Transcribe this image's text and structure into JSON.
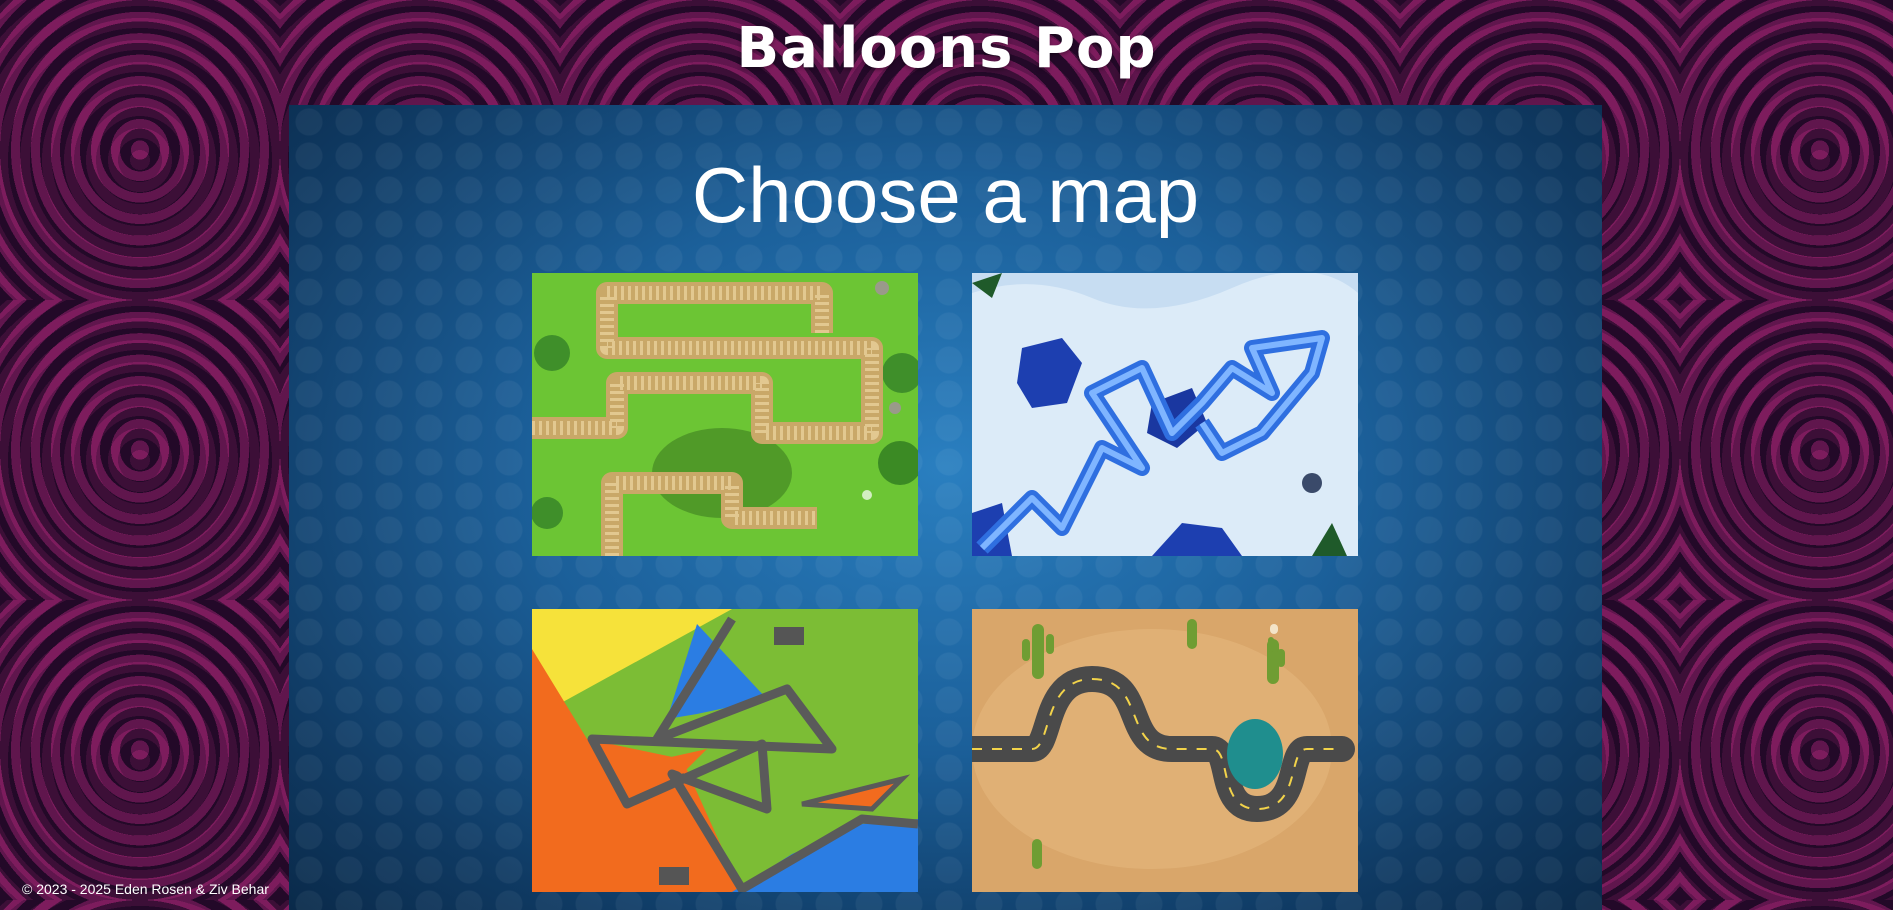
{
  "header": {
    "title": "Balloons Pop"
  },
  "map_select": {
    "heading": "Choose a map",
    "maps": [
      {
        "theme": "grass-path",
        "image_icon": "grass-map-thumbnail"
      },
      {
        "theme": "ice-path",
        "image_icon": "ice-map-thumbnail"
      },
      {
        "theme": "colorful-tiles",
        "image_icon": "tile-map-thumbnail"
      },
      {
        "theme": "desert-road",
        "image_icon": "desert-map-thumbnail"
      }
    ]
  },
  "footer": {
    "copyright": "© 2023 - 2025 Eden Rosen & Ziv Behar"
  },
  "colors": {
    "page_background": "#3a0f3c",
    "board_background": "#1b5f99",
    "text": "#ffffff"
  }
}
